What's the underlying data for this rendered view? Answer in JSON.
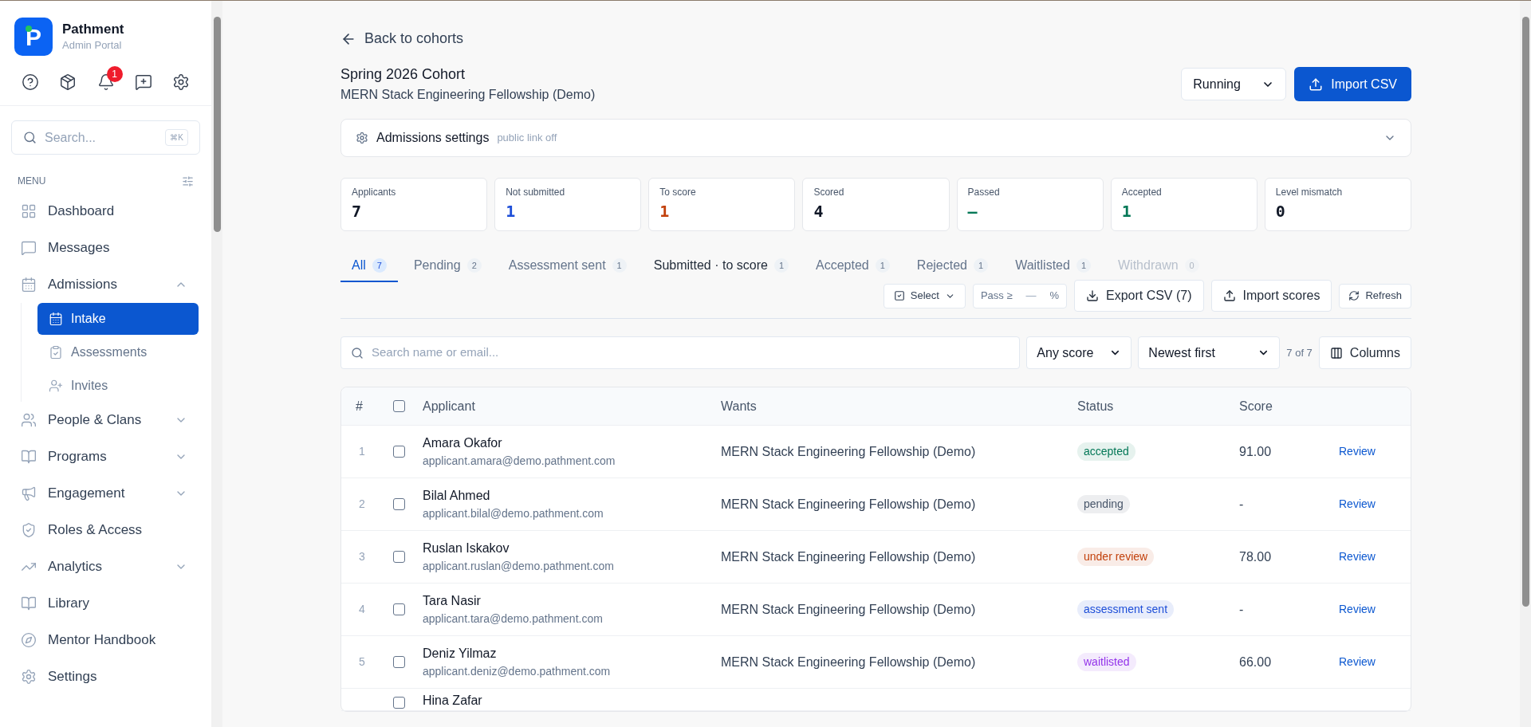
{
  "brand": {
    "name": "Pathment",
    "subtitle": "Admin Portal",
    "logo_letter": "P"
  },
  "notification_badge": "1",
  "sidebar_search": {
    "placeholder": "Search...",
    "shortcut": "⌘K"
  },
  "menu_label": "MENU",
  "nav": [
    {
      "label": "Dashboard",
      "selected": false
    },
    {
      "label": "Messages",
      "selected": false
    },
    {
      "label": "Admissions",
      "selected": false,
      "expanded": true,
      "children": [
        {
          "label": "Intake",
          "selected": true
        },
        {
          "label": "Assessments",
          "selected": false
        },
        {
          "label": "Invites",
          "selected": false
        }
      ]
    },
    {
      "label": "People & Clans",
      "selected": false,
      "expanded": false
    },
    {
      "label": "Programs",
      "selected": false,
      "expanded": false
    },
    {
      "label": "Engagement",
      "selected": false,
      "expanded": false
    },
    {
      "label": "Roles & Access",
      "selected": false
    },
    {
      "label": "Analytics",
      "selected": false,
      "expanded": false
    },
    {
      "label": "Library",
      "selected": false
    },
    {
      "label": "Mentor Handbook",
      "selected": false
    },
    {
      "label": "Settings",
      "selected": false
    }
  ],
  "back_link": "Back to cohorts",
  "cohort": {
    "title": "Spring 2026 Cohort",
    "subtitle": "MERN Stack Engineering Fellowship (Demo)"
  },
  "status_select": "Running",
  "import_button": "Import CSV",
  "settings_panel": {
    "title": "Admissions settings",
    "note": "public link off",
    "expanded": false
  },
  "stats": [
    {
      "label": "Applicants",
      "value": "7",
      "color": "#111827"
    },
    {
      "label": "Not submitted",
      "value": "1",
      "color": "#1d4ed8"
    },
    {
      "label": "To score",
      "value": "1",
      "color": "#c2410c"
    },
    {
      "label": "Scored",
      "value": "4",
      "color": "#111827"
    },
    {
      "label": "Passed",
      "value": "—",
      "color": "#047857"
    },
    {
      "label": "Accepted",
      "value": "1",
      "color": "#047857"
    },
    {
      "label": "Level mismatch",
      "value": "0",
      "color": "#111827"
    }
  ],
  "tabs": [
    {
      "label": "All",
      "count": "7",
      "selected": true,
      "disabled": false,
      "emphasized": false
    },
    {
      "label": "Pending",
      "count": "2",
      "selected": false,
      "disabled": false,
      "emphasized": false
    },
    {
      "label": "Assessment sent",
      "count": "1",
      "selected": false,
      "disabled": false,
      "emphasized": false
    },
    {
      "label": "Submitted · to score",
      "count": "1",
      "selected": false,
      "disabled": false,
      "emphasized": true
    },
    {
      "label": "Accepted",
      "count": "1",
      "selected": false,
      "disabled": false,
      "emphasized": false
    },
    {
      "label": "Rejected",
      "count": "1",
      "selected": false,
      "disabled": false,
      "emphasized": false
    },
    {
      "label": "Waitlisted",
      "count": "1",
      "selected": false,
      "disabled": false,
      "emphasized": false
    },
    {
      "label": "Withdrawn",
      "count": "0",
      "selected": false,
      "disabled": true,
      "emphasized": false
    }
  ],
  "toolbar": {
    "select": "Select",
    "pass_label": "Pass ≥",
    "pass_placeholder": "—",
    "pass_unit": "%",
    "export": "Export CSV (7)",
    "import_scores": "Import scores",
    "refresh": "Refresh"
  },
  "filters": {
    "search_placeholder": "Search name or email...",
    "score_filter": "Any score",
    "sort": "Newest first",
    "count": "7 of 7",
    "columns_button": "Columns"
  },
  "table": {
    "columns": [
      "#",
      "Applicant",
      "Wants",
      "Status",
      "Score"
    ],
    "select_all_checked": false,
    "rows": [
      {
        "index": "1",
        "name": "Amara Okafor",
        "email": "applicant.amara@demo.pathment.com",
        "wants": "MERN Stack Engineering Fellowship (Demo)",
        "status": "accepted",
        "color": "#047857",
        "score": "91.00",
        "action": "Review",
        "checked": false
      },
      {
        "index": "2",
        "name": "Bilal Ahmed",
        "email": "applicant.bilal@demo.pathment.com",
        "wants": "MERN Stack Engineering Fellowship (Demo)",
        "status": "pending",
        "color": "#475569",
        "score": "-",
        "action": "Review",
        "checked": false
      },
      {
        "index": "3",
        "name": "Ruslan Iskakov",
        "email": "applicant.ruslan@demo.pathment.com",
        "wants": "MERN Stack Engineering Fellowship (Demo)",
        "status": "under review",
        "color": "#c2410c",
        "score": "78.00",
        "action": "Review",
        "checked": false
      },
      {
        "index": "4",
        "name": "Tara Nasir",
        "email": "applicant.tara@demo.pathment.com",
        "wants": "MERN Stack Engineering Fellowship (Demo)",
        "status": "assessment sent",
        "color": "#1d4ed8",
        "score": "-",
        "action": "Review",
        "checked": false
      },
      {
        "index": "5",
        "name": "Deniz Yilmaz",
        "email": "applicant.deniz@demo.pathment.com",
        "wants": "MERN Stack Engineering Fellowship (Demo)",
        "status": "waitlisted",
        "color": "#9333ea",
        "score": "66.00",
        "action": "Review",
        "checked": false
      },
      {
        "name": "Hina Zafar",
        "checked": false
      }
    ]
  }
}
